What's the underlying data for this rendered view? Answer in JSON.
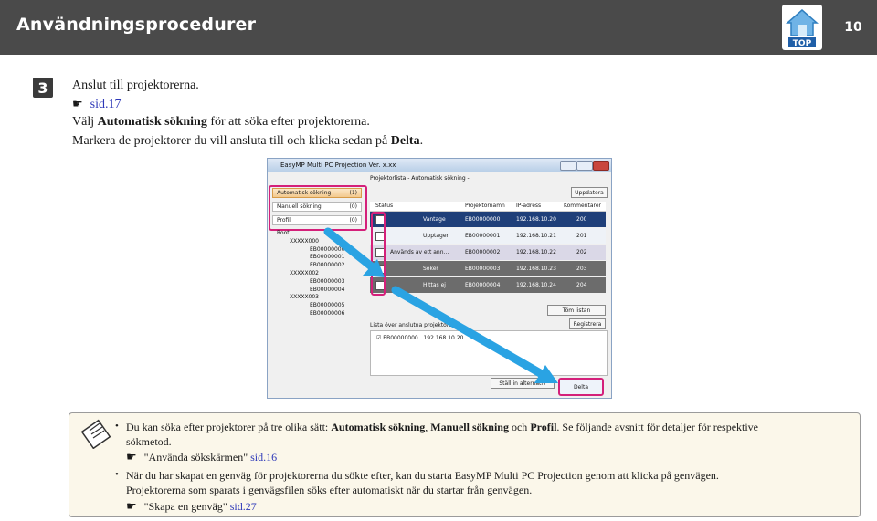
{
  "header": {
    "title": "Användningsprocedurer",
    "logo_text": "TOP",
    "page_number": "10"
  },
  "step": {
    "number": "3",
    "lines": {
      "l1": "Anslut till projektorerna.",
      "l2_link": "sid.17",
      "l3_pre": "Välj ",
      "l3_bold": "Automatisk sökning",
      "l3_post": " för att söka efter projektorerna.",
      "l4_pre": "Markera de projektorer du vill ansluta till och klicka sedan på ",
      "l4_bold": "Delta",
      "l4_post": "."
    }
  },
  "screenshot": {
    "window_title": "EasyMP Multi PC Projection Ver. x.xx",
    "breadcrumb": "Projektorlista - Automatisk sökning -",
    "update_button": "Uppdatera",
    "side_buttons": [
      {
        "label": "Automatisk sökning",
        "count": "(1)"
      },
      {
        "label": "Manuell sökning",
        "count": "(0)"
      },
      {
        "label": "Profil",
        "count": "(0)"
      }
    ],
    "tree": [
      "Root",
      "XXXXX000",
      "EB00000000",
      "EB00000001",
      "EB00000002",
      "XXXXX002",
      "EB00000003",
      "EB00000004",
      "XXXXX003",
      "EB00000005",
      "EB00000006"
    ],
    "columns": [
      "Status",
      "Projektornamn",
      "IP-adress",
      "Kommentarer"
    ],
    "rows": [
      {
        "status": "Vantage",
        "name": "EB00000000",
        "ip": "192.168.10.20",
        "comment": "200"
      },
      {
        "status": "Upptagen",
        "name": "EB00000001",
        "ip": "192.168.10.21",
        "comment": "201"
      },
      {
        "status": "Används av ett ann...",
        "name": "EB00000002",
        "ip": "192.168.10.22",
        "comment": "202"
      },
      {
        "status": "Söker",
        "name": "EB00000003",
        "ip": "192.168.10.23",
        "comment": "203"
      },
      {
        "status": "Hittas ej",
        "name": "EB00000004",
        "ip": "192.168.10.24",
        "comment": "204"
      }
    ],
    "btn_clear": "Töm listan",
    "btn_register": "Registrera",
    "list_title": "Lista över anslutna projektorer",
    "list_item_name": "EB00000000",
    "list_item_ip": "192.168.10.20",
    "btn_settings": "Ställ in alternativ",
    "btn_join": "Delta"
  },
  "note": {
    "b1_pre": "Du kan söka efter projektorer på tre olika sätt: ",
    "b1_bold1": "Automatisk sökning",
    "b1_sep1": ", ",
    "b1_bold2": "Manuell sökning",
    "b1_sep2": " och ",
    "b1_bold3": "Profil",
    "b1_post": ". Se följande avsnitt för detaljer för respektive",
    "b1_cont": "sökmetod.",
    "b1_ref_text": "\"Använda sökskärmen\" ",
    "b1_ref_link": "sid.16",
    "b2_line1": "När du har skapat en genväg för projektorerna du sökte efter, kan du starta EasyMP Multi PC Projection genom att klicka på genvägen.",
    "b2_line2": "Projektorerna som sparats i genvägsfilen söks efter automatiskt när du startar från genvägen.",
    "b2_ref_text": "\"Skapa en genväg\" ",
    "b2_ref_link": "sid.27"
  }
}
